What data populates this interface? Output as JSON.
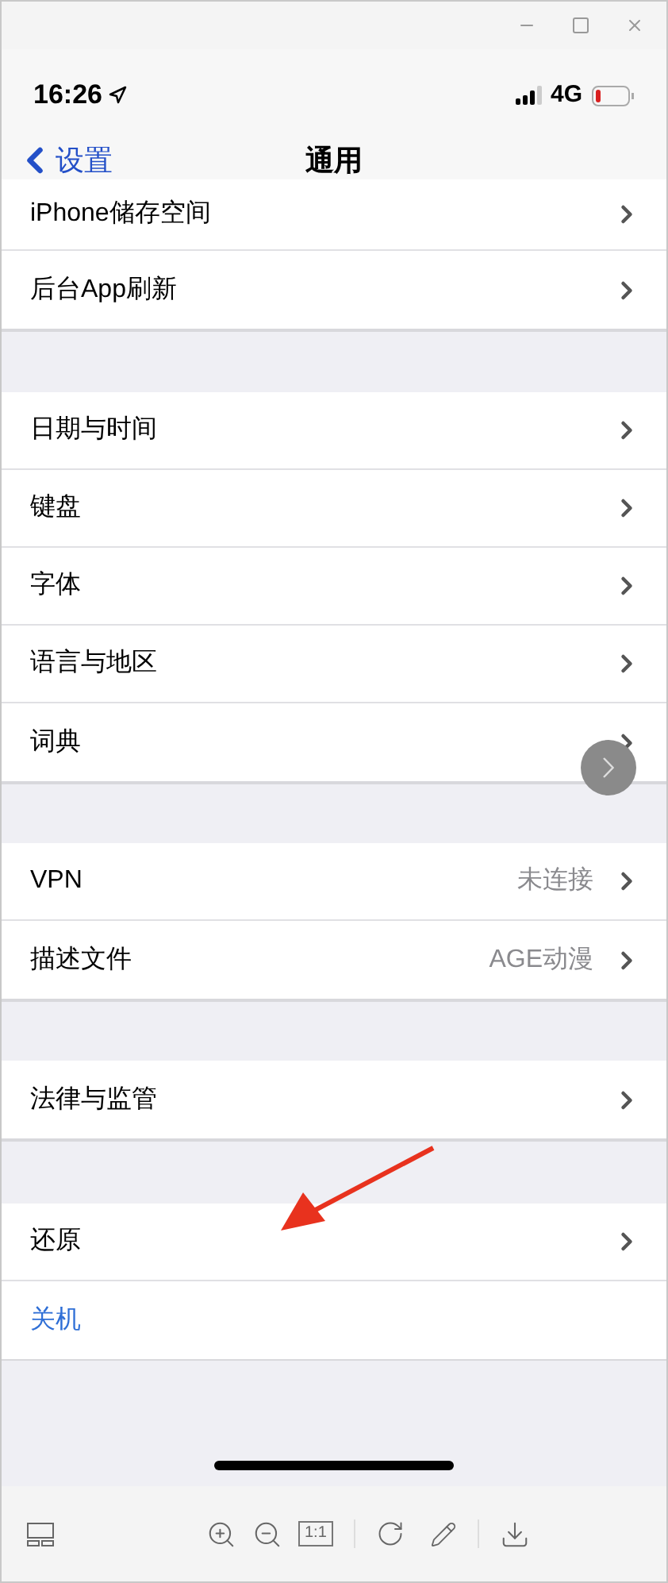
{
  "status_bar": {
    "time": "16:26",
    "network": "4G"
  },
  "nav": {
    "back": "设置",
    "title": "通用"
  },
  "groups": [
    {
      "rows": [
        {
          "kind": "link",
          "label": "iPhone储存空间"
        },
        {
          "kind": "link",
          "label": "后台App刷新"
        }
      ]
    },
    {
      "rows": [
        {
          "kind": "link",
          "label": "日期与时间"
        },
        {
          "kind": "link",
          "label": "键盘"
        },
        {
          "kind": "link",
          "label": "字体"
        },
        {
          "kind": "link",
          "label": "语言与地区"
        },
        {
          "kind": "link",
          "label": "词典"
        }
      ]
    },
    {
      "rows": [
        {
          "kind": "link",
          "label": "VPN",
          "value": "未连接"
        },
        {
          "kind": "link",
          "label": "描述文件",
          "value": "AGE动漫"
        }
      ]
    },
    {
      "rows": [
        {
          "kind": "link",
          "label": "法律与监管"
        }
      ]
    },
    {
      "rows": [
        {
          "kind": "link",
          "label": "还原"
        },
        {
          "kind": "action",
          "label": "关机"
        }
      ]
    }
  ],
  "toolbar": {
    "actual_size": "1:1"
  }
}
